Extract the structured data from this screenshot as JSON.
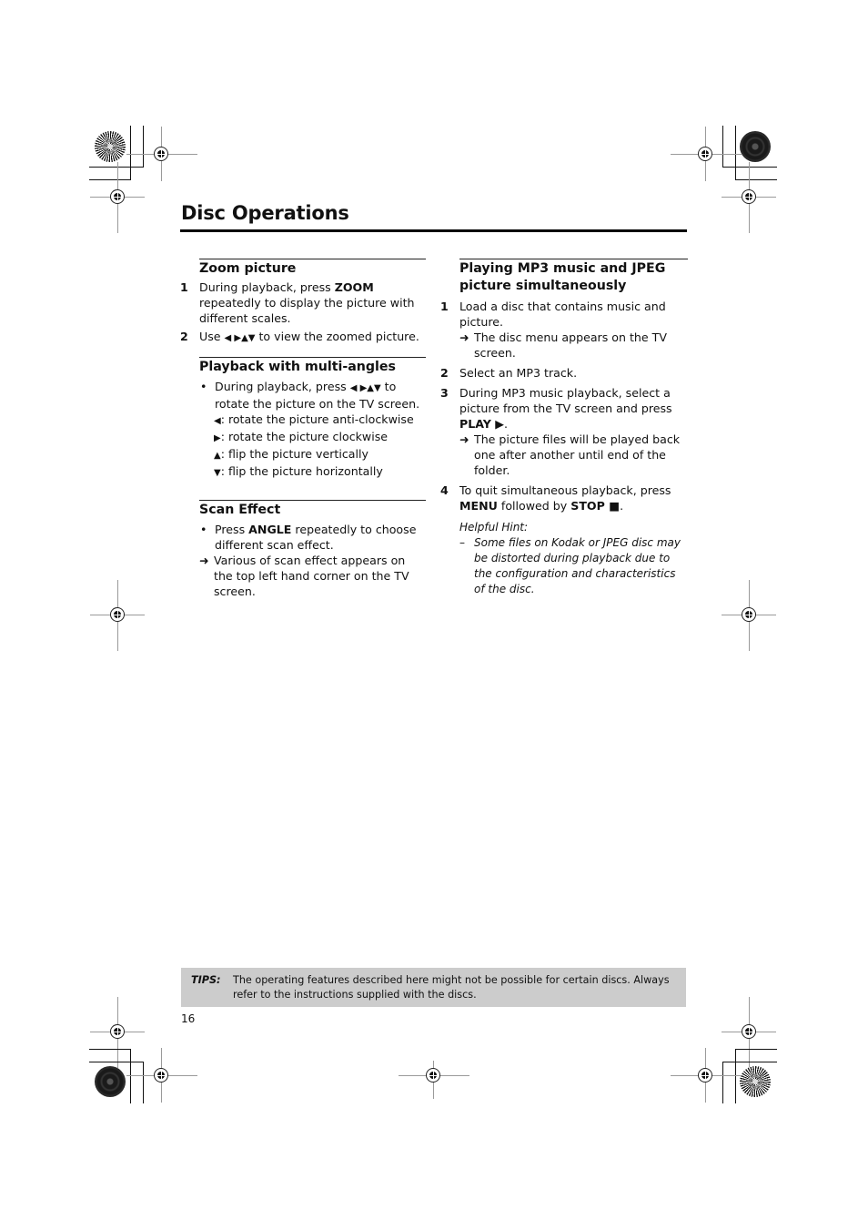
{
  "page": {
    "title": "Disc Operations",
    "page_number": "16"
  },
  "left_column": {
    "zoom": {
      "heading": "Zoom picture",
      "steps": [
        {
          "num": "1",
          "pre": "During playback, press ",
          "key": "ZOOM",
          "post": " repeatedly to display the picture with different scales."
        },
        {
          "num": "2",
          "pre": "Use ",
          "glyphs": "◀ ▶▲▼",
          "post": " to view the zoomed picture."
        }
      ]
    },
    "multi_angle": {
      "heading": "Playback with multi-angles",
      "bullet_pre": "During playback, press ",
      "bullet_glyphs": "◀ ▶▲▼",
      "bullet_post": " to rotate the picture on the TV screen.",
      "items": [
        {
          "glyph": "◀",
          "text": ": rotate the picture anti-clockwise"
        },
        {
          "glyph": "▶",
          "text": ": rotate the picture clockwise"
        },
        {
          "glyph": "▲",
          "text": ": flip the picture vertically"
        },
        {
          "glyph": "▼",
          "text": ": flip the picture horizontally"
        }
      ]
    },
    "scan": {
      "heading": "Scan Effect",
      "bullet_pre": "Press ",
      "bullet_key": "ANGLE",
      "bullet_post": " repeatedly to choose different scan effect.",
      "result": "Various of scan effect appears on the top left hand corner on the TV screen."
    }
  },
  "right_column": {
    "heading": "Playing MP3 music and JPEG picture simultaneously",
    "steps": [
      {
        "num": "1",
        "text": "Load a disc that contains music and picture.",
        "result": "The disc menu appears on the TV screen."
      },
      {
        "num": "2",
        "text": "Select an MP3 track."
      },
      {
        "num": "3",
        "text": "During MP3 music playback, select a picture from the TV screen and press ",
        "key": "PLAY ▶",
        "post": ".",
        "result": "The picture files will be played back one after another until end of the folder."
      },
      {
        "num": "4",
        "text": "To quit simultaneous playback, press ",
        "key": "MENU",
        "mid": " followed by ",
        "key2": "STOP ■",
        "post": "."
      }
    ],
    "hint_title": "Helpful Hint:",
    "hint_dash": "–",
    "hint_text": "Some files on Kodak or JPEG disc may be distorted during playback due to the configuration and characteristics of the disc."
  },
  "tips": {
    "label": "TIPS:",
    "text": "The operating features described here might not be possible for certain discs. Always refer to the instructions supplied with the discs."
  },
  "glyphs": {
    "bullet": "•",
    "arrow": "➜"
  }
}
